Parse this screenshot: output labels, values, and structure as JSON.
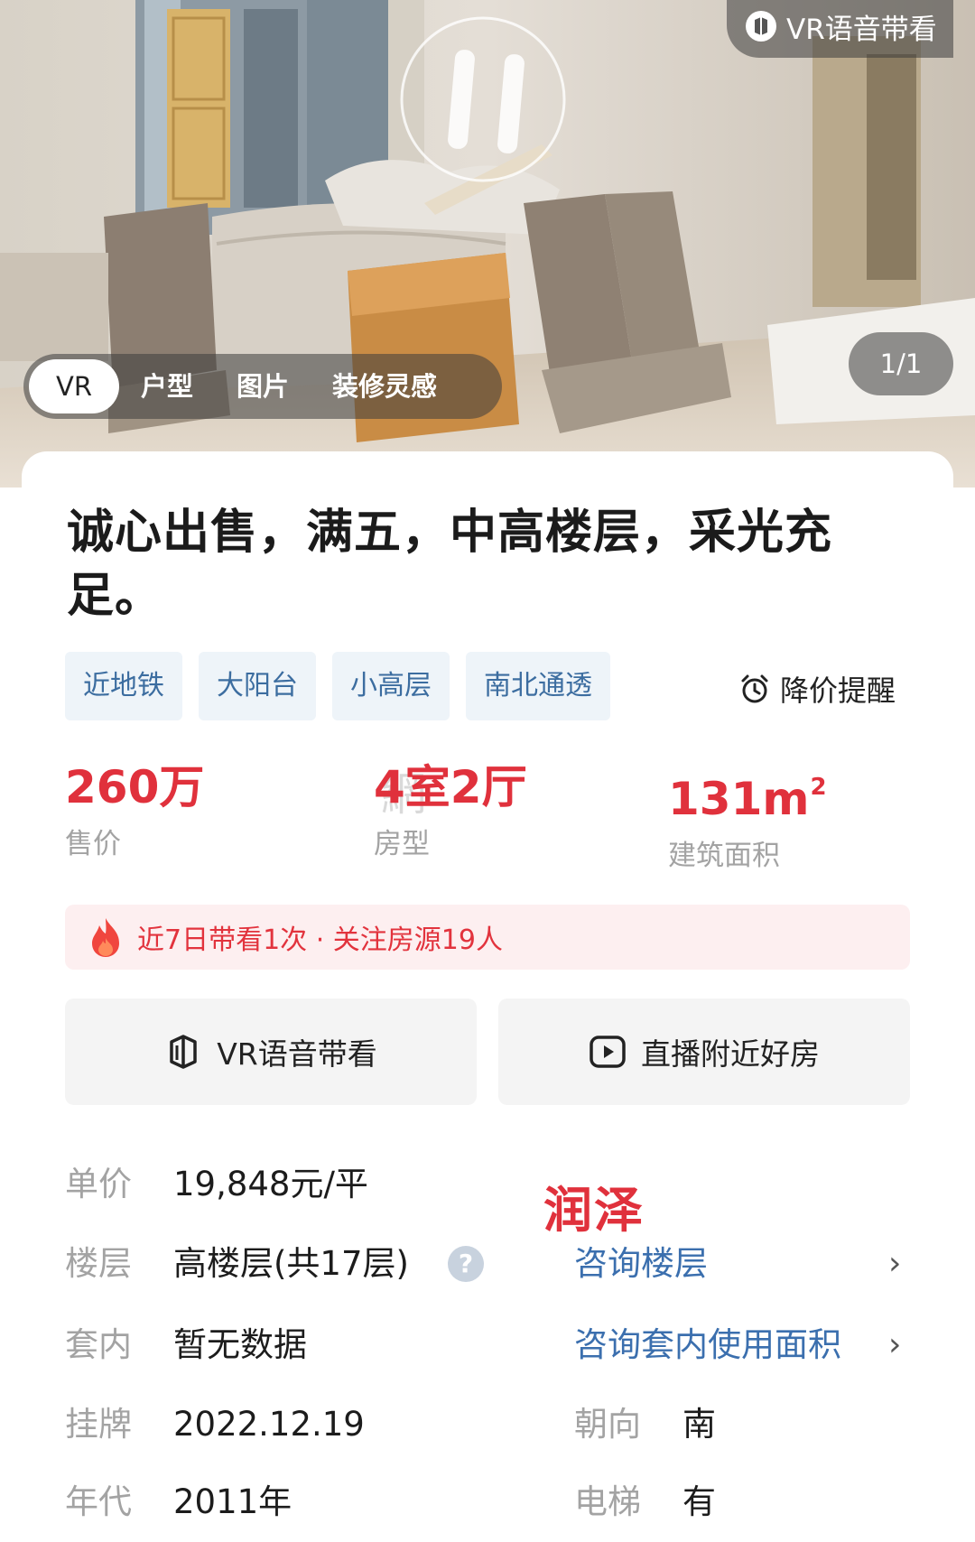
{
  "hero": {
    "vr_voice_label": "VR语音带看",
    "counter": "1/1",
    "tabs": [
      {
        "label": "VR"
      },
      {
        "label": "户型"
      },
      {
        "label": "图片"
      },
      {
        "label": "装修灵感"
      }
    ],
    "icons": [
      "vr-icon",
      "play-pause-icon"
    ]
  },
  "listing": {
    "title": "诚心出售，满五，中高楼层，采光充足。",
    "tags": [
      "近地铁",
      "大阳台",
      "小高层",
      "南北通透"
    ],
    "price_alert": "降价提醒",
    "stats": [
      {
        "value": "260万",
        "label": "售价"
      },
      {
        "value": "4室2厅",
        "label": "房型"
      },
      {
        "value": "131m",
        "unit_sup": "2",
        "label": "建筑面积"
      }
    ],
    "hot_info": "近7日带看1次 · 关注房源19人",
    "actions": {
      "vr_voice": "VR语音带看",
      "live": "直播附近好房"
    },
    "details": {
      "unit_price_key": "单价",
      "unit_price": "19,848元/平",
      "floor_key": "楼层",
      "floor": "高楼层(共17层)",
      "floor_link": "咨询楼层",
      "inner_key": "套内",
      "inner": "暂无数据",
      "inner_link": "咨询套内使用面积",
      "listed_key": "挂牌",
      "listed": "2022.12.19",
      "orientation_key": "朝向",
      "orientation": "南",
      "year_key": "年代",
      "year": "2011年",
      "elevator_key": "电梯",
      "elevator": "有"
    },
    "watermark_red": "润泽"
  },
  "colors": {
    "accent_red": "#e0313c",
    "link_blue": "#3b6fae",
    "tag_bg": "#eef4f9",
    "tag_text": "#3c6da0"
  }
}
